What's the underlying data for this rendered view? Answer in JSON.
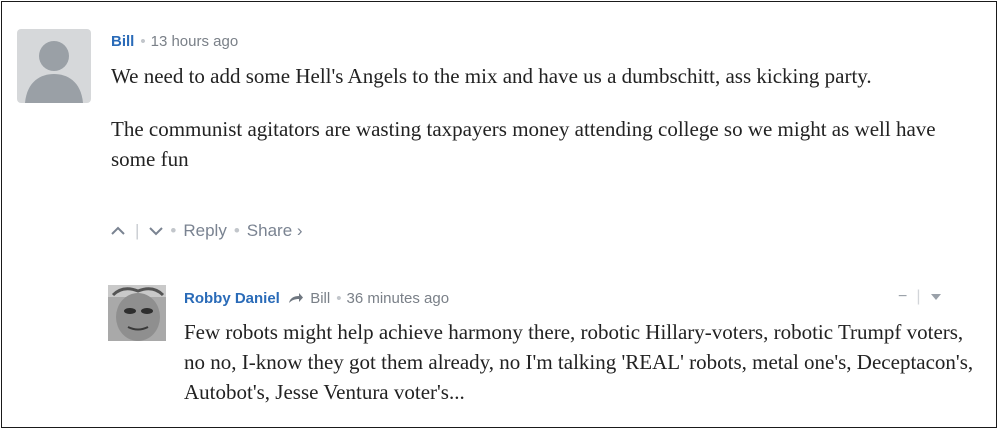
{
  "comment": {
    "author": "Bill",
    "timestamp": "13 hours ago",
    "paragraphs": [
      "We need to add some Hell's Angels to the mix and have us a dumbschitt, ass kicking party.",
      "The communist agitators are wasting taxpayers money attending college so we might as well have some fun"
    ],
    "actions": {
      "upvote_icon": "chevron-up-icon",
      "downvote_icon": "chevron-down-icon",
      "reply_label": "Reply",
      "share_label": "Share ›"
    }
  },
  "reply": {
    "author": "Robby Daniel",
    "reply_to_icon": "reply-arrow-icon",
    "reply_to": "Bill",
    "timestamp": "36 minutes ago",
    "text": "Few robots might help achieve harmony there, robotic Hillary-voters, robotic Trumpf voters, no no, I-know they got them already, no I'm talking 'REAL' robots, metal one's, Deceptacon's, Autobot's, Jesse Ventura voter's...",
    "controls": {
      "collapse_label": "−",
      "menu_icon": "chevron-down-icon"
    }
  }
}
